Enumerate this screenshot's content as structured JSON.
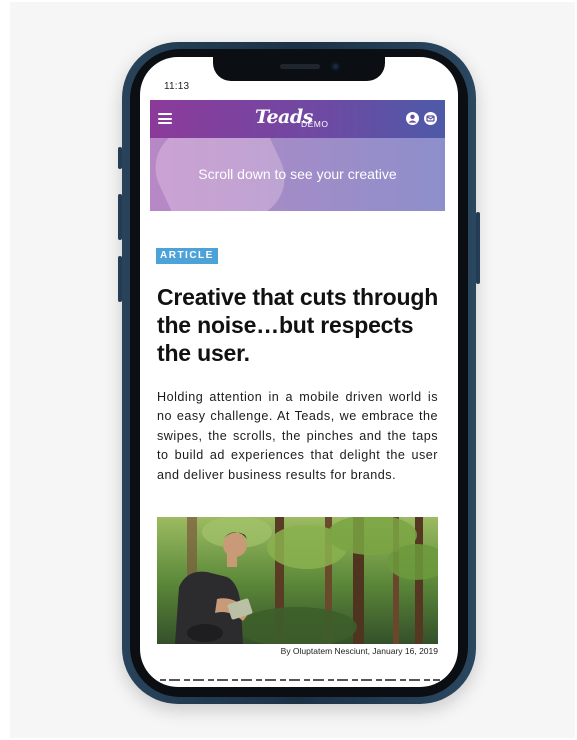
{
  "status_bar": {
    "time": "11:13"
  },
  "app_bar": {
    "logo": "Teads",
    "logo_suffix": "DEMO",
    "background_start": "#8c3a9a",
    "background_end": "#4d5aa8",
    "icons": [
      "menu-icon",
      "user-icon",
      "mail-icon"
    ]
  },
  "hero": {
    "text": "Scroll down to see your creative"
  },
  "article": {
    "badge": "ARTICLE",
    "badge_color": "#4da3d8",
    "headline": "Creative that cuts through the noise…but respects the user.",
    "body": "Holding attention in a mobile driven world is no easy challenge. At Teads, we embrace the swipes, the scrolls, the pinches and the taps to build ad experiences that delight the user and deliver business results for brands.",
    "image_alt": "man-reading-tablet-in-forest",
    "caption": "By Oluptatem Nesciunt, January 16, 2019"
  }
}
